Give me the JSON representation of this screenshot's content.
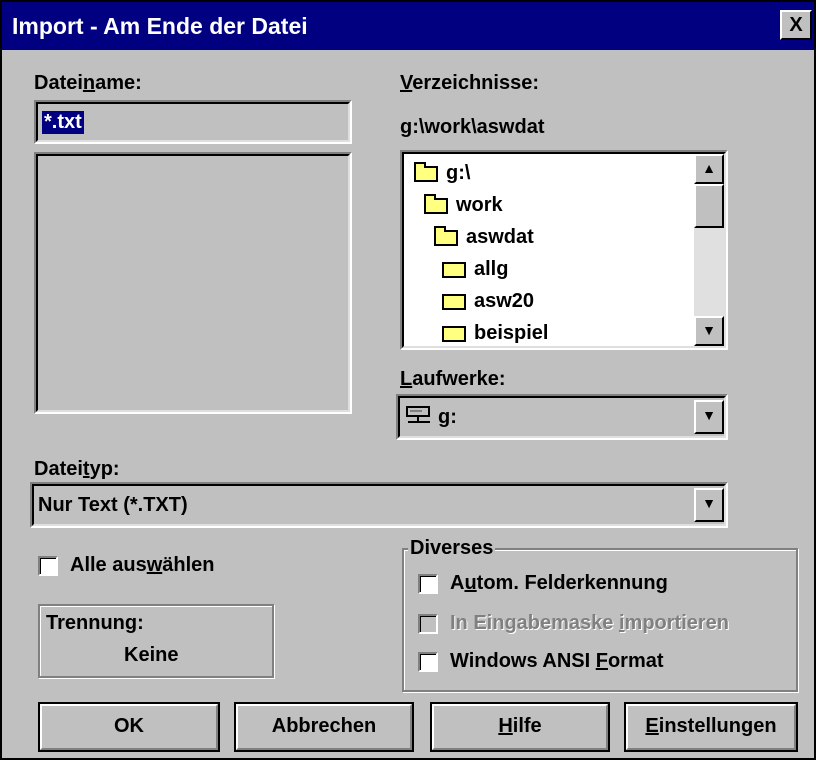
{
  "dialog": {
    "title": "Import - Am Ende der Datei",
    "close_label": "X"
  },
  "filename": {
    "label_pre": "Datei",
    "label_hot": "n",
    "label_post": "ame:",
    "value": "*.txt",
    "files": []
  },
  "directories": {
    "label_hot": "V",
    "label_post": "erzeichnisse:",
    "current_path": "g:\\work\\aswdat",
    "tree": [
      {
        "label": "g:\\",
        "icon": "folder-open-icon"
      },
      {
        "label": "work",
        "icon": "folder-open-icon"
      },
      {
        "label": "aswdat",
        "icon": "folder-open-icon"
      },
      {
        "label": "allg",
        "icon": "folder-icon"
      },
      {
        "label": "asw20",
        "icon": "folder-icon"
      },
      {
        "label": "beispiel",
        "icon": "folder-icon"
      }
    ]
  },
  "drives": {
    "label_hot": "L",
    "label_post": "aufwerke:",
    "value": "g:",
    "icon": "network-drive-icon"
  },
  "filetype": {
    "label_pre": "Datei",
    "label_hot": "t",
    "label_post": "yp:",
    "value": "Nur Text (*.TXT)"
  },
  "select_all": {
    "label_pre": "Alle aus",
    "label_hot": "w",
    "label_post": "ählen",
    "checked": false
  },
  "separator": {
    "label": "Trennung:",
    "value": "Keine"
  },
  "misc": {
    "group_label": "Diverses",
    "options": [
      {
        "pre": "A",
        "hot": "u",
        "post": "tom. Felderkennung",
        "enabled": true,
        "checked": false
      },
      {
        "pre": "In Eingabemaske ",
        "hot": "i",
        "post": "mportieren",
        "enabled": false,
        "checked": false
      },
      {
        "pre": "Windows ANSI ",
        "hot": "F",
        "post": "ormat",
        "enabled": true,
        "checked": false
      }
    ]
  },
  "buttons": {
    "ok": "OK",
    "cancel": "Abbrechen",
    "help_hot": "H",
    "help_post": "ilfe",
    "settings_hot": "E",
    "settings_post": "instellungen"
  }
}
